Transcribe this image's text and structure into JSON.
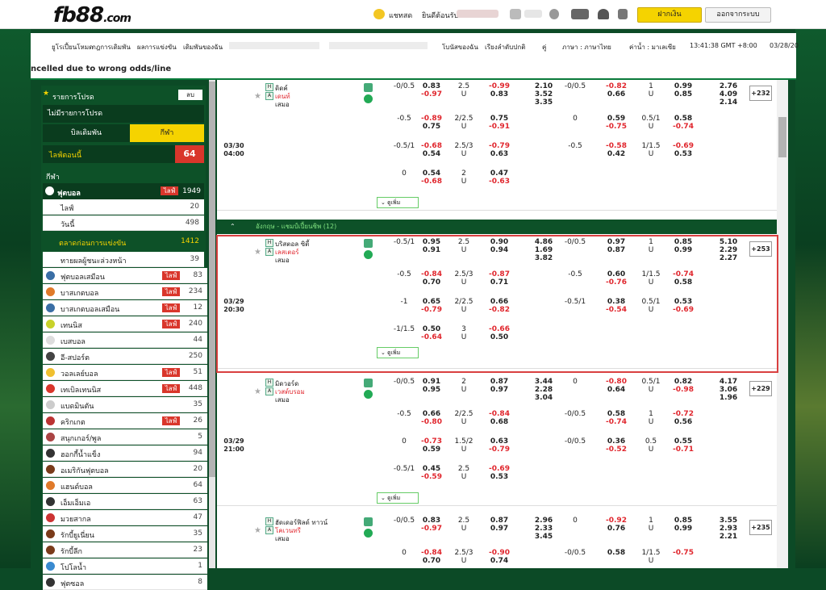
{
  "header": {
    "logo": "fb88",
    "logo_tld": ".com",
    "chat": "แชทสด",
    "greeting": "ยินดีต้อนรับ",
    "deposit": "ฝากเงิน",
    "logout": "ออกจากระบบ"
  },
  "nav": {
    "items": [
      "ยูโรเปี้ยนโหมด",
      "กฎการเดิมพัน",
      "ผลการแข่งขัน",
      "เดิมพันของฉัน",
      "โบนัสของฉัน",
      "เรียงลำดับปกติ",
      "คู่",
      "ภาษา : ภาษาไทย",
      "ค่าน้ำ : มาเลเซีย",
      "13:41:38 GMT +8:00",
      "03/28/20"
    ]
  },
  "ticker": "ncelled due to wrong odds/line",
  "sidebar": {
    "fav_label": "รายการโปรด",
    "fav_btn": "ลบ",
    "no_fav": "ไม่มีรายการโปรด",
    "tab_bet": "บิลเดิมพัน",
    "tab_sports": "กีฬา",
    "live_label": "ไลฟ์ตอนนี้",
    "live_count": "64",
    "sports_header": "กีฬา",
    "football": {
      "label": "ฟุตบอล",
      "live": "ไลฟ์",
      "count": "1949"
    },
    "sub": [
      {
        "label": "ไลฟ์",
        "count": "20"
      },
      {
        "label": "วันนี้",
        "count": "498"
      },
      {
        "label": "ตลาดก่อนการแข่งขัน",
        "count": "1412"
      },
      {
        "label": "ทายผลผู้ชนะล่วงหน้า",
        "count": "39"
      }
    ],
    "sports": [
      {
        "label": "ฟุตบอลเสมือน",
        "live": "ไลฟ์",
        "count": "83",
        "color": "#3a6ea5"
      },
      {
        "label": "บาสเกตบอล",
        "live": "ไลฟ์",
        "count": "234",
        "color": "#e07a2a"
      },
      {
        "label": "บาสเกตบอลเสมือน",
        "live": "ไลฟ์",
        "count": "12",
        "color": "#3a6ea5"
      },
      {
        "label": "เทนนิส",
        "live": "ไลฟ์",
        "count": "240",
        "color": "#c8d22a"
      },
      {
        "label": "เบสบอล",
        "live": "",
        "count": "44",
        "color": "#ddd"
      },
      {
        "label": "อี-สปอร์ต",
        "live": "",
        "count": "250",
        "color": "#444"
      },
      {
        "label": "วอลเลย์บอล",
        "live": "ไลฟ์",
        "count": "51",
        "color": "#f0c030"
      },
      {
        "label": "เทเบิลเทนนิส",
        "live": "ไลฟ์",
        "count": "448",
        "color": "#d9362b"
      },
      {
        "label": "แบดมินตัน",
        "live": "",
        "count": "35",
        "color": "#ccc"
      },
      {
        "label": "คริกเกต",
        "live": "ไลฟ์",
        "count": "26",
        "color": "#b33"
      },
      {
        "label": "สนุกเกอร์/พูล",
        "live": "",
        "count": "5",
        "color": "#a44"
      },
      {
        "label": "ฮอกกี้น้ำแข็ง",
        "live": "",
        "count": "94",
        "color": "#333"
      },
      {
        "label": "อเมริกันฟุตบอล",
        "live": "",
        "count": "20",
        "color": "#7a3b1a"
      },
      {
        "label": "แฮนด์บอล",
        "live": "",
        "count": "64",
        "color": "#e07a2a"
      },
      {
        "label": "เอ็มเอ็มเอ",
        "live": "",
        "count": "63",
        "color": "#333"
      },
      {
        "label": "มวยสากล",
        "live": "",
        "count": "47",
        "color": "#c33"
      },
      {
        "label": "รักบี้ยูเนี่ยน",
        "live": "",
        "count": "35",
        "color": "#7a3b1a"
      },
      {
        "label": "รักบี้ลีก",
        "live": "",
        "count": "23",
        "color": "#7a3b1a"
      },
      {
        "label": "โปโลน้ำ",
        "live": "",
        "count": "1",
        "color": "#3a8ad0"
      },
      {
        "label": "ฟุตซอล",
        "live": "",
        "count": "8",
        "color": "#333"
      }
    ]
  },
  "more_label": "ดูเพิ่ม",
  "league": "อังกฤษ - แชมป์เปี้ยนชิพ (12)",
  "matches": [
    {
      "date": "03/30",
      "time": "04:00",
      "home": "ดิดค์",
      "away": "เดนท์",
      "draw": "เสมอ",
      "extra": "+232",
      "rows": [
        [
          "-0/0.5",
          "0.83",
          "2.5",
          "-0.99",
          "2.10",
          "-0/0.5",
          "-0.82",
          "1",
          "0.99",
          "2.76"
        ],
        [
          "",
          "-0.97",
          "U",
          "0.83",
          "3.52",
          "",
          "0.66",
          "U",
          "0.85",
          "4.09"
        ],
        [
          "",
          "",
          "",
          "",
          "3.35",
          "",
          "",
          "",
          "",
          "2.14"
        ],
        [
          "-0.5",
          "-0.89",
          "2/2.5",
          "0.75",
          "",
          "0",
          "0.59",
          "0.5/1",
          "0.58",
          ""
        ],
        [
          "",
          "0.75",
          "U",
          "-0.91",
          "",
          "",
          "-0.75",
          "U",
          "-0.74",
          ""
        ],
        [
          "-0.5/1",
          "-0.68",
          "2.5/3",
          "-0.79",
          "",
          "-0.5",
          "-0.58",
          "1/1.5",
          "-0.69",
          ""
        ],
        [
          "",
          "0.54",
          "U",
          "0.63",
          "",
          "",
          "0.42",
          "U",
          "0.53",
          ""
        ],
        [
          "0",
          "0.54",
          "2",
          "0.47",
          "",
          "",
          "",
          "",
          "",
          ""
        ],
        [
          "",
          "-0.68",
          "U",
          "-0.63",
          "",
          "",
          "",
          "",
          "",
          ""
        ]
      ]
    },
    {
      "date": "03/29",
      "time": "20:30",
      "home": "บริสตอล ซิตี้",
      "away": "เลสเตอร์",
      "draw": "เสมอ",
      "extra": "+253",
      "rows": [
        [
          "-0.5/1",
          "0.95",
          "2.5",
          "0.90",
          "4.86",
          "-0/0.5",
          "0.97",
          "1",
          "0.85",
          "5.10"
        ],
        [
          "",
          "0.91",
          "U",
          "0.94",
          "1.69",
          "",
          "0.87",
          "U",
          "0.99",
          "2.29"
        ],
        [
          "",
          "",
          "",
          "",
          "3.82",
          "",
          "",
          "",
          "",
          "2.27"
        ],
        [
          "-0.5",
          "-0.84",
          "2.5/3",
          "-0.87",
          "",
          "-0.5",
          "0.60",
          "1/1.5",
          "-0.74",
          ""
        ],
        [
          "",
          "0.70",
          "U",
          "0.71",
          "",
          "",
          "-0.76",
          "U",
          "0.58",
          ""
        ],
        [
          "-1",
          "0.65",
          "2/2.5",
          "0.66",
          "",
          "-0.5/1",
          "0.38",
          "0.5/1",
          "0.53",
          ""
        ],
        [
          "",
          "-0.79",
          "U",
          "-0.82",
          "",
          "",
          "-0.54",
          "U",
          "-0.69",
          ""
        ],
        [
          "-1/1.5",
          "0.50",
          "3",
          "-0.66",
          "",
          "",
          "",
          "",
          "",
          ""
        ],
        [
          "",
          "-0.64",
          "U",
          "0.50",
          "",
          "",
          "",
          "",
          "",
          ""
        ]
      ]
    },
    {
      "date": "03/29",
      "time": "21:00",
      "home": "มิดวอร์ด",
      "away": "เวสต์บรอม",
      "draw": "เสมอ",
      "extra": "+229",
      "rows": [
        [
          "-0/0.5",
          "0.91",
          "2",
          "0.87",
          "3.44",
          "0",
          "-0.80",
          "0.5/1",
          "0.82",
          "4.17"
        ],
        [
          "",
          "0.95",
          "U",
          "0.97",
          "2.28",
          "",
          "0.64",
          "U",
          "-0.98",
          "3.06"
        ],
        [
          "",
          "",
          "",
          "",
          "3.04",
          "",
          "",
          "",
          "",
          "1.96"
        ],
        [
          "-0.5",
          "0.66",
          "2/2.5",
          "-0.84",
          "",
          "-0/0.5",
          "0.58",
          "1",
          "-0.72",
          ""
        ],
        [
          "",
          "-0.80",
          "U",
          "0.68",
          "",
          "",
          "-0.74",
          "U",
          "0.56",
          ""
        ],
        [
          "0",
          "-0.73",
          "1.5/2",
          "0.63",
          "",
          "-0/0.5",
          "0.36",
          "0.5",
          "0.55",
          ""
        ],
        [
          "",
          "0.59",
          "U",
          "-0.79",
          "",
          "",
          "-0.52",
          "U",
          "-0.71",
          ""
        ],
        [
          "-0.5/1",
          "0.45",
          "2.5",
          "-0.69",
          "",
          "",
          "",
          "",
          "",
          ""
        ],
        [
          "",
          "-0.59",
          "U",
          "0.53",
          "",
          "",
          "",
          "",
          "",
          ""
        ]
      ]
    },
    {
      "date": "",
      "time": "",
      "home": "ฮัดเดอร์ฟิลด์ ทาวน์",
      "away": "โคเวนทรี",
      "draw": "เสมอ",
      "extra": "+235",
      "rows": [
        [
          "-0/0.5",
          "0.83",
          "2.5",
          "0.87",
          "2.96",
          "0",
          "-0.92",
          "1",
          "0.85",
          "3.55"
        ],
        [
          "",
          "-0.97",
          "U",
          "0.97",
          "2.33",
          "",
          "0.76",
          "U",
          "0.99",
          "2.93"
        ],
        [
          "",
          "",
          "",
          "",
          "3.45",
          "",
          "",
          "",
          "",
          "2.21"
        ],
        [
          "0",
          "-0.84",
          "2.5/3",
          "-0.90",
          "",
          "-0/0.5",
          "0.58",
          "1/1.5",
          "-0.75",
          ""
        ],
        [
          "",
          "0.70",
          "U",
          "0.74",
          "",
          "",
          "",
          "U",
          "",
          ""
        ]
      ]
    }
  ]
}
